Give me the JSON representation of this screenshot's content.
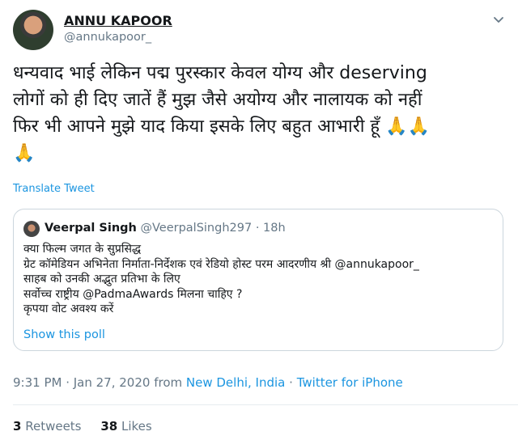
{
  "author": {
    "name": "ANNU KAPOOR",
    "handle": "@annukapoor_"
  },
  "tweet": {
    "text_lines": [
      "धन्यवाद भाई लेकिन पद्म पुरस्कार केवल योग्य और deserving",
      "लोगों को ही दिए जातें हैं मुझ जैसे अयोग्य और नालायक को नहीं",
      "फिर भी आपने मुझे याद किया इसके लिए बहुत आभारी हूँ",
      ""
    ],
    "emoji_inline": "🙏🙏",
    "emoji_next": "🙏",
    "translate_label": "Translate Tweet"
  },
  "quoted": {
    "name": "Veerpal Singh",
    "handle": "@VeerpalSingh297",
    "separator": "·",
    "time": "18h",
    "lines": [
      "क्या फिल्म जगत के सुप्रसिद्ध",
      "ग्रेट कॉमेडियन अभिनेता निर्माता-निर्देशक एवं रेडियो होस्ट परम आदरणीय श्री @annukapoor_",
      " साहब को उनकी अद्भुत प्रतिभा के लिए",
      "सर्वोच्च राष्ट्रीय @PadmaAwards मिलना चाहिए ?",
      "कृपया वोट अवश्य करें"
    ],
    "show_poll": "Show this poll"
  },
  "meta": {
    "datetime": "9:31 PM · Jan 27, 2020 from",
    "location": "New Delhi, India",
    "dot": "·",
    "source": "Twitter for iPhone"
  },
  "stats": {
    "retweets_count": "3",
    "retweets_label": "Retweets",
    "likes_count": "38",
    "likes_label": "Likes"
  },
  "colors": {
    "link": "#1b95e0",
    "secondary": "#657786",
    "border": "#ccd6dd"
  }
}
